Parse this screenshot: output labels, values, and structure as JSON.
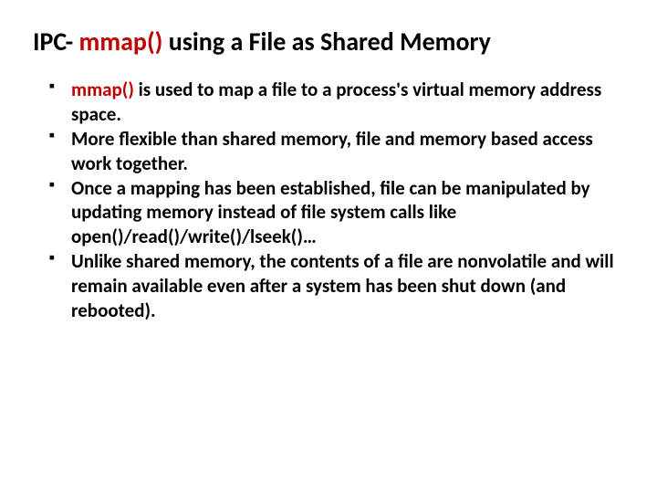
{
  "title": {
    "prefix": "IPC- ",
    "accent": "mmap()",
    "suffix": " using a File as Shared Memory"
  },
  "bullets": [
    {
      "accent": "mmap()",
      "rest": " is used to map a file to a process's virtual memory address space."
    },
    {
      "accent": "",
      "rest": "More flexible than shared memory, file and memory based access work together."
    },
    {
      "accent": "",
      "rest": "Once a mapping has been established, file can be manipulated by updating memory instead of file system calls like open()/read()/write()/lseek()…"
    },
    {
      "accent": "",
      "rest": "Unlike shared memory, the contents of a file are nonvolatile and will remain available even after a system has been shut down (and rebooted)."
    }
  ]
}
